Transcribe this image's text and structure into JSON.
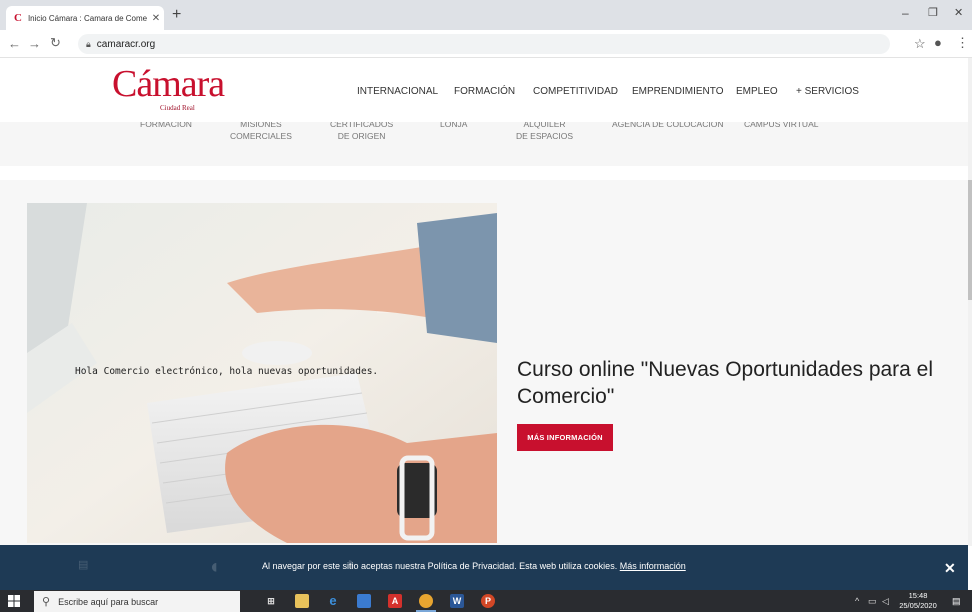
{
  "browser": {
    "tab_title": "Inicio Cámara : Camara de Come",
    "tab_close": "✕",
    "new_tab": "+",
    "url": "camaracr.org",
    "win_minimize": "–",
    "win_restore": "❐",
    "win_close": "✕"
  },
  "site": {
    "logo_text": "ámara",
    "logo_initial": "C",
    "logo_sub": "Ciudad Real",
    "nav": [
      "INTERNACIONAL",
      "FORMACIÓN",
      "COMPETITIVIDAD",
      "EMPRENDIMIENTO",
      "EMPLEO",
      "+ SERVICIOS"
    ],
    "submenu": [
      {
        "line1": "FORMACIÓN",
        "line2": ""
      },
      {
        "line1": "MISIONES",
        "line2": "COMERCIALES"
      },
      {
        "line1": "CERTIFICADOS",
        "line2": "DE ORIGEN"
      },
      {
        "line1": "LONJA",
        "line2": ""
      },
      {
        "line1": "ALQUILER",
        "line2": "DE ESPACIOS"
      },
      {
        "line1": "AGENCIA DE COLOCACIÓN",
        "line2": ""
      },
      {
        "line1": "CAMPUS VIRTUAL",
        "line2": ""
      }
    ]
  },
  "hero": {
    "caption": "Hola Comercio electrónico, hola nuevas oportunidades.",
    "title": "Curso online \"Nuevas Oportunidades para el Comercio\"",
    "cta": "MÁS INFORMACIÓN"
  },
  "cookie": {
    "text": "Al navegar por este sitio aceptas nuestra Política de Privacidad. Esta web utiliza cookies.",
    "link": "Más información",
    "close": "✕"
  },
  "taskbar": {
    "search_placeholder": "Escribe aquí para buscar",
    "time": "15:48",
    "date": "25/05/2020"
  },
  "colors": {
    "brand_red": "#c8102e",
    "cookie_bg": "#1e3a55",
    "taskbar_bg": "#2a2c30"
  }
}
